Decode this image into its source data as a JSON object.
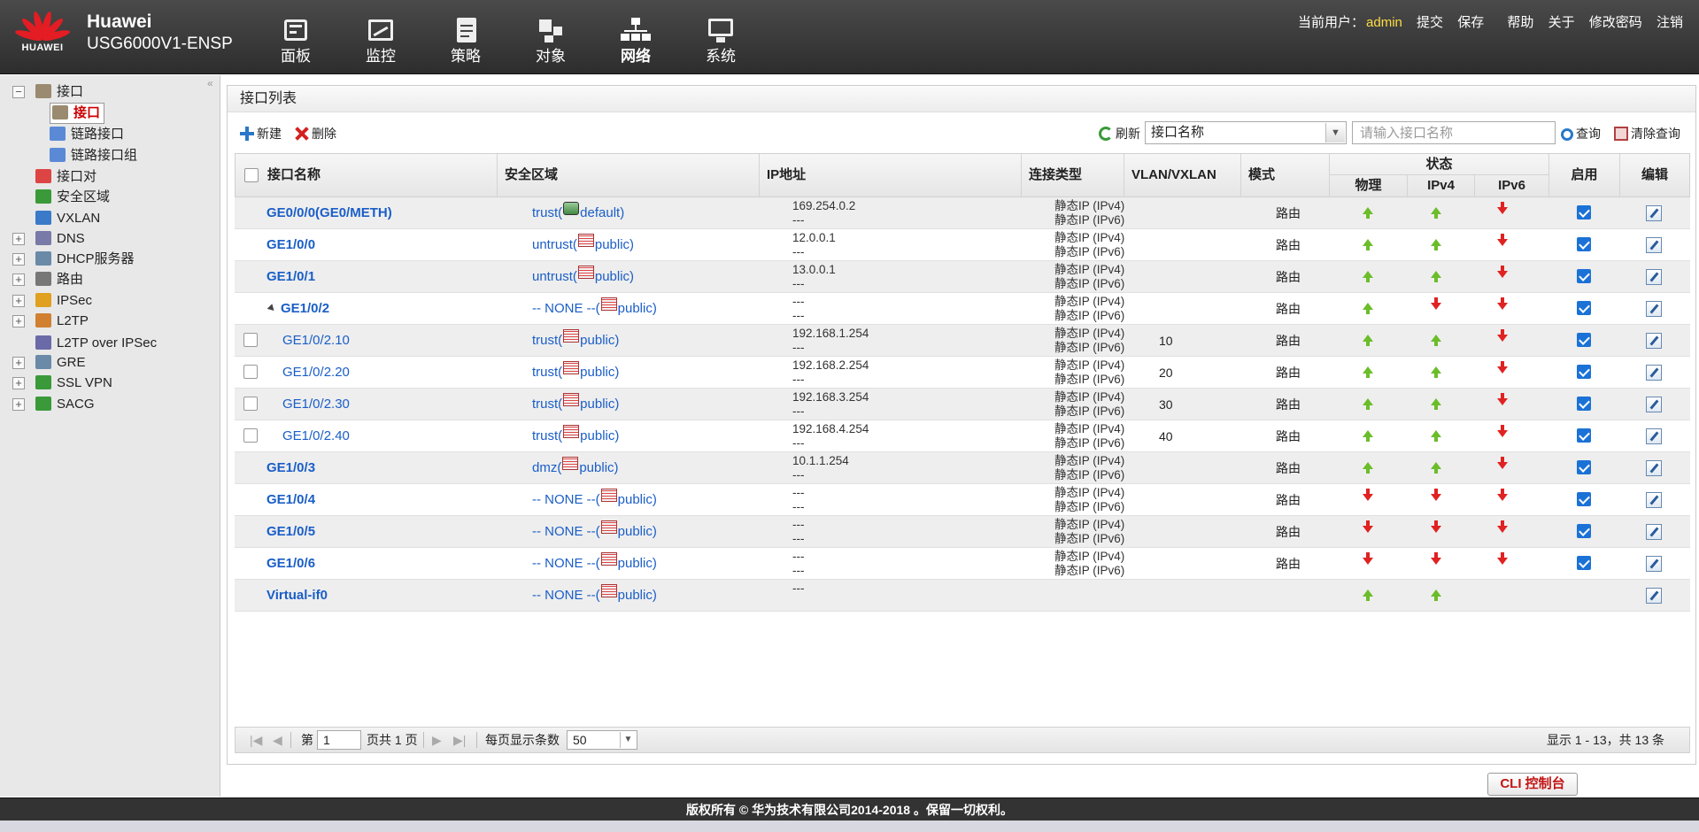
{
  "brand": {
    "logo_text": "HUAWEI",
    "vendor": "Huawei",
    "model": "USG6000V1-ENSP"
  },
  "nav": [
    {
      "label": "面板",
      "icon": "dashboard-icon"
    },
    {
      "label": "监控",
      "icon": "monitor-icon"
    },
    {
      "label": "策略",
      "icon": "policy-icon"
    },
    {
      "label": "对象",
      "icon": "object-icon"
    },
    {
      "label": "网络",
      "icon": "network-icon",
      "active": true
    },
    {
      "label": "系统",
      "icon": "system-icon"
    }
  ],
  "user": {
    "current_label": "当前用户：",
    "username": "admin",
    "submit": "提交",
    "save": "保存",
    "help": "帮助",
    "about": "关于",
    "change_password": "修改密码",
    "logout": "注销"
  },
  "tree": [
    {
      "label": "接口",
      "toggle": "−"
    },
    {
      "label": "接口"
    },
    {
      "label": "链路接口"
    },
    {
      "label": "链路接口组"
    },
    {
      "label": "接口对"
    },
    {
      "label": "安全区域"
    },
    {
      "label": "VXLAN"
    },
    {
      "label": "DNS",
      "toggle": "+"
    },
    {
      "label": "DHCP服务器",
      "toggle": "+"
    },
    {
      "label": "路由",
      "toggle": "+"
    },
    {
      "label": "IPSec",
      "toggle": "+"
    },
    {
      "label": "L2TP",
      "toggle": "+"
    },
    {
      "label": "L2TP over IPSec"
    },
    {
      "label": "GRE",
      "toggle": "+"
    },
    {
      "label": "SSL VPN",
      "toggle": "+"
    },
    {
      "label": "SACG",
      "toggle": "+"
    }
  ],
  "panel": {
    "title": "接口列表",
    "new": "新建",
    "delete": "删除",
    "refresh": "刷新",
    "filter_value": "接口名称",
    "search_placeholder": "请输入接口名称",
    "query": "查询",
    "clear_query": "清除查询"
  },
  "columns": {
    "name": "接口名称",
    "zone": "安全区域",
    "ip": "IP地址",
    "conn": "连接类型",
    "vlan": "VLAN/VXLAN",
    "mode": "模式",
    "status": "状态",
    "phys": "物理",
    "ipv4": "IPv4",
    "ipv6": "IPv6",
    "enable": "启用",
    "edit": "编辑"
  },
  "rows": [
    {
      "name": "GE0/0/0(GE0/METH)",
      "zone_pre": "trust(",
      "zone_vsys": "default)",
      "ip1": "169.254.0.2",
      "ip2": "---",
      "c1": "静态IP (IPv4)",
      "c2": "静态IP (IPv6)",
      "vlan": "",
      "mode": "路由",
      "phys": "up",
      "v4": "up",
      "v6": "down",
      "enabled": true,
      "level": 0,
      "checkbox": false,
      "zone_icon": "g"
    },
    {
      "name": "GE1/0/0",
      "zone_pre": "untrust(",
      "zone_vsys": "public)",
      "ip1": "12.0.0.1",
      "ip2": "---",
      "c1": "静态IP (IPv4)",
      "c2": "静态IP (IPv6)",
      "vlan": "",
      "mode": "路由",
      "phys": "up",
      "v4": "up",
      "v6": "down",
      "enabled": true,
      "level": 0,
      "checkbox": false
    },
    {
      "name": "GE1/0/1",
      "zone_pre": "untrust(",
      "zone_vsys": "public)",
      "ip1": "13.0.0.1",
      "ip2": "---",
      "c1": "静态IP (IPv4)",
      "c2": "静态IP (IPv6)",
      "vlan": "",
      "mode": "路由",
      "phys": "up",
      "v4": "up",
      "v6": "down",
      "enabled": true,
      "level": 0,
      "checkbox": false
    },
    {
      "name": "GE1/0/2",
      "zone_pre": "-- NONE --(",
      "zone_vsys": "public)",
      "ip1": "---",
      "ip2": "---",
      "c1": "静态IP (IPv4)",
      "c2": "静态IP (IPv6)",
      "vlan": "",
      "mode": "路由",
      "phys": "up",
      "v4": "down",
      "v6": "down",
      "enabled": true,
      "level": 0,
      "checkbox": false,
      "expander": true
    },
    {
      "name": "GE1/0/2.10",
      "zone_pre": "trust(",
      "zone_vsys": "public)",
      "ip1": "192.168.1.254",
      "ip2": "---",
      "c1": "静态IP (IPv4)",
      "c2": "静态IP (IPv6)",
      "vlan": "10",
      "mode": "路由",
      "phys": "up",
      "v4": "up",
      "v6": "down",
      "enabled": true,
      "level": 1,
      "checkbox": true
    },
    {
      "name": "GE1/0/2.20",
      "zone_pre": "trust(",
      "zone_vsys": "public)",
      "ip1": "192.168.2.254",
      "ip2": "---",
      "c1": "静态IP (IPv4)",
      "c2": "静态IP (IPv6)",
      "vlan": "20",
      "mode": "路由",
      "phys": "up",
      "v4": "up",
      "v6": "down",
      "enabled": true,
      "level": 1,
      "checkbox": true
    },
    {
      "name": "GE1/0/2.30",
      "zone_pre": "trust(",
      "zone_vsys": "public)",
      "ip1": "192.168.3.254",
      "ip2": "---",
      "c1": "静态IP (IPv4)",
      "c2": "静态IP (IPv6)",
      "vlan": "30",
      "mode": "路由",
      "phys": "up",
      "v4": "up",
      "v6": "down",
      "enabled": true,
      "level": 1,
      "checkbox": true
    },
    {
      "name": "GE1/0/2.40",
      "zone_pre": "trust(",
      "zone_vsys": "public)",
      "ip1": "192.168.4.254",
      "ip2": "---",
      "c1": "静态IP (IPv4)",
      "c2": "静态IP (IPv6)",
      "vlan": "40",
      "mode": "路由",
      "phys": "up",
      "v4": "up",
      "v6": "down",
      "enabled": true,
      "level": 1,
      "checkbox": true
    },
    {
      "name": "GE1/0/3",
      "zone_pre": "dmz(",
      "zone_vsys": "public)",
      "ip1": "10.1.1.254",
      "ip2": "---",
      "c1": "静态IP (IPv4)",
      "c2": "静态IP (IPv6)",
      "vlan": "",
      "mode": "路由",
      "phys": "up",
      "v4": "up",
      "v6": "down",
      "enabled": true,
      "level": 0,
      "checkbox": false
    },
    {
      "name": "GE1/0/4",
      "zone_pre": "-- NONE --(",
      "zone_vsys": "public)",
      "ip1": "---",
      "ip2": "---",
      "c1": "静态IP (IPv4)",
      "c2": "静态IP (IPv6)",
      "vlan": "",
      "mode": "路由",
      "phys": "down",
      "v4": "down",
      "v6": "down",
      "enabled": true,
      "level": 0,
      "checkbox": false
    },
    {
      "name": "GE1/0/5",
      "zone_pre": "-- NONE --(",
      "zone_vsys": "public)",
      "ip1": "---",
      "ip2": "---",
      "c1": "静态IP (IPv4)",
      "c2": "静态IP (IPv6)",
      "vlan": "",
      "mode": "路由",
      "phys": "down",
      "v4": "down",
      "v6": "down",
      "enabled": true,
      "level": 0,
      "checkbox": false
    },
    {
      "name": "GE1/0/6",
      "zone_pre": "-- NONE --(",
      "zone_vsys": "public)",
      "ip1": "---",
      "ip2": "---",
      "c1": "静态IP (IPv4)",
      "c2": "静态IP (IPv6)",
      "vlan": "",
      "mode": "路由",
      "phys": "down",
      "v4": "down",
      "v6": "down",
      "enabled": true,
      "level": 0,
      "checkbox": false
    },
    {
      "name": "Virtual-if0",
      "zone_pre": "-- NONE --(",
      "zone_vsys": "public)",
      "ip1": "---",
      "ip2": "",
      "c1": "",
      "c2": "",
      "vlan": "",
      "mode": "",
      "phys": "up",
      "v4": "up",
      "v6": "",
      "enabled": null,
      "level": 0,
      "checkbox": false
    }
  ],
  "pager": {
    "page_label": "第",
    "page_value": "1",
    "page_total": "页共 1 页",
    "per_page_label": "每页显示条数",
    "per_page_value": "50",
    "summary": "显示 1 - 13，共 13 条"
  },
  "cli": "CLI 控制台",
  "footer": "版权所有 © 华为技术有限公司2014-2018 。保留一切权利。"
}
